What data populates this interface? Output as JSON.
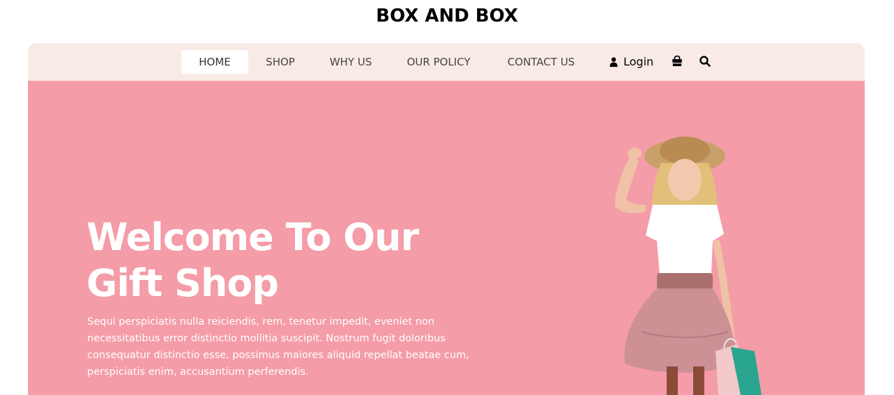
{
  "brand": {
    "name": "BOX AND BOX"
  },
  "nav": {
    "items": [
      {
        "label": "HOME",
        "active": true
      },
      {
        "label": "SHOP",
        "active": false
      },
      {
        "label": "WHY US",
        "active": false
      },
      {
        "label": "OUR POLICY",
        "active": false
      },
      {
        "label": "CONTACT US",
        "active": false
      }
    ],
    "login_label": "Login",
    "icons": [
      "user-icon",
      "shopping-bag-icon",
      "search-icon"
    ]
  },
  "hero": {
    "title_line1": "Welcome To Our",
    "title_line2": "Gift Shop",
    "text": "Sequi perspiciatis nulla reiciendis, rem, tenetur impedit, eveniet non necessitatibus error distinctio mollitia suscipit. Nostrum fugit doloribus consequatur distinctio esse, possimus maiores aliquid repellat beatae cum, perspiciatis enim, accusantium perferendis.",
    "image": "girl-with-hat-holding-shopping-bags"
  },
  "colors": {
    "hero_bg": "#f49ca7",
    "nav_bg": "#f8ebe6",
    "active_tab_bg": "#ffffff",
    "text_dark": "#000000"
  }
}
